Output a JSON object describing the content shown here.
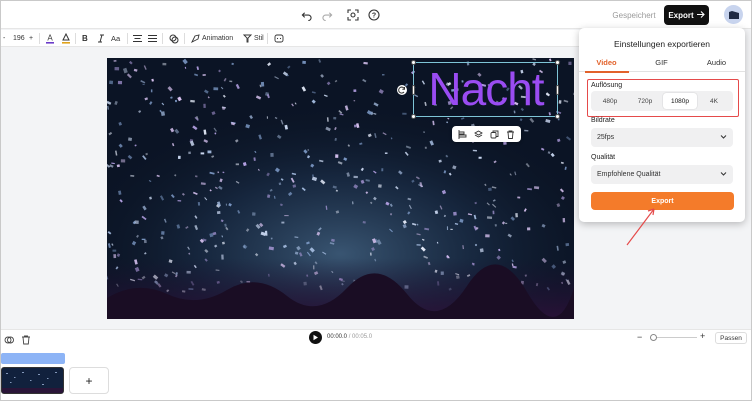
{
  "header": {
    "saved_label": "Gespeichert",
    "export_label": "Export",
    "icons": [
      "undo-icon",
      "redo-icon",
      "screenshot-icon",
      "help-icon",
      "arrow-right-icon",
      "avatar-icon"
    ]
  },
  "toolbar": {
    "font_size": "196",
    "minus": "-",
    "plus": "+",
    "bold": "B",
    "text_case": "Aa",
    "animation_label": "Animation",
    "style_label": "Stil"
  },
  "canvas": {
    "headline_text": "Nacht"
  },
  "export_panel": {
    "title": "Einstellungen exportieren",
    "tabs": [
      "Video",
      "GIF",
      "Audio"
    ],
    "active_tab": "Video",
    "resolution_label": "Auflösung",
    "resolutions": [
      "480p",
      "720p",
      "1080p",
      "4K"
    ],
    "selected_resolution": "1080p",
    "framerate_label": "Bildrate",
    "framerate_value": "25fps",
    "quality_label": "Qualität",
    "quality_value": "Empfohlene Qualität",
    "export_button": "Export"
  },
  "playback": {
    "current_time": "00:00.0",
    "separator": "/",
    "duration": "00:05.0",
    "fit_label": "Passen",
    "zoom_minus": "−",
    "zoom_plus": "+"
  },
  "timeline": {
    "add_label": "+"
  },
  "colors": {
    "accent_orange": "#f47b2a",
    "tab_active": "#e2622b",
    "highlight_red": "#e54a4a",
    "headline_purple": "#9a4cf2"
  }
}
